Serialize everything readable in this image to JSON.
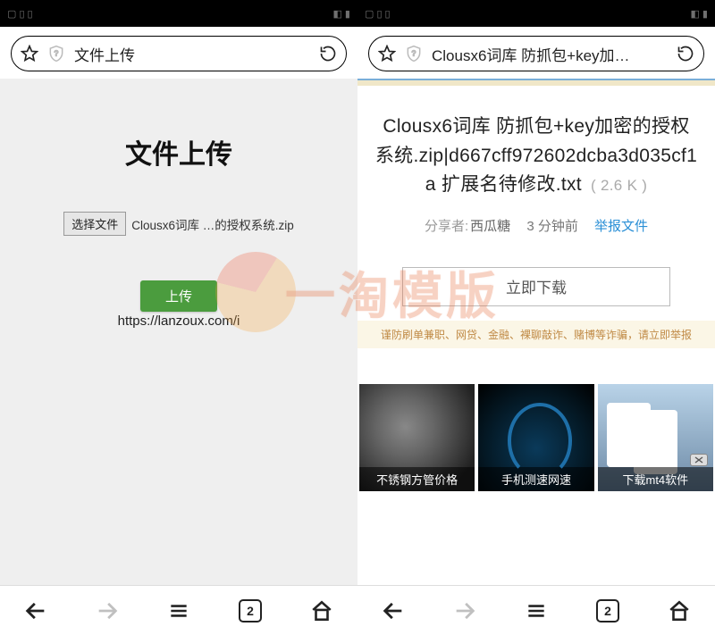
{
  "statusbar": {
    "time": ""
  },
  "left": {
    "address_title": "文件上传",
    "page_heading": "文件上传",
    "choose_label": "选择文件",
    "chosen_file": "Clousx6词库 …的授权系统.zip",
    "upload_label": "上传",
    "result_url": "https://lanzoux.com/i"
  },
  "right": {
    "address_title": "Clousx6词库 防抓包+key加…",
    "file_title_pre": "Clousx6词库 防抓包+key加密的授权系统.zip|d667cff972602dcba3d035cf1a 扩展名待修改.txt",
    "file_size": "( 2.6 K )",
    "share_label": "分享者:",
    "share_name": "西瓜糖",
    "time_ago": "3 分钟前",
    "report_label": "举报文件",
    "download_label": "立即下载",
    "warning": "谨防刷单兼职、网贷、金融、裸聊敲诈、赌博等诈骗，请立即举报",
    "ads": [
      {
        "caption": "不锈钢方管价格"
      },
      {
        "caption": "手机测速网速"
      },
      {
        "caption": "下载mt4软件"
      }
    ]
  },
  "nav": {
    "tab_count": "2"
  },
  "watermark": "一淘模版"
}
